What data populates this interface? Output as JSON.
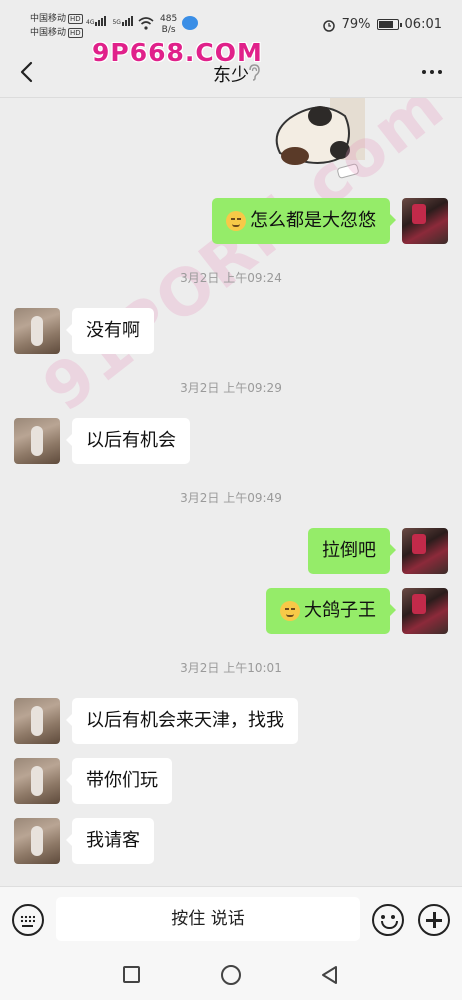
{
  "status_bar": {
    "carrier1": "中国移动",
    "carrier2": "中国移动",
    "hd": "HD",
    "net1": "4G",
    "net2": "5G",
    "speed_value": "485",
    "speed_unit": "B/s",
    "battery": "79%",
    "time": "06:01",
    "watermark": "9P668.COM"
  },
  "nav": {
    "title": "东少"
  },
  "watermark_diag": "91PORN.com",
  "messages": [
    {
      "side": "right",
      "text": "怎么都是大忽悠",
      "emoji": true
    },
    {
      "type": "time",
      "text": "3月2日 上午09:24"
    },
    {
      "side": "left",
      "text": "没有啊"
    },
    {
      "type": "time",
      "text": "3月2日 上午09:29"
    },
    {
      "side": "left",
      "text": "以后有机会"
    },
    {
      "type": "time",
      "text": "3月2日 上午09:49"
    },
    {
      "side": "right",
      "text": "拉倒吧"
    },
    {
      "side": "right",
      "text": "大鸽子王",
      "emoji": true
    },
    {
      "type": "time",
      "text": "3月2日 上午10:01"
    },
    {
      "side": "left",
      "text": "以后有机会来天津，找我"
    },
    {
      "side": "left",
      "text": "带你们玩"
    },
    {
      "side": "left",
      "text": "我请客"
    }
  ],
  "input_bar": {
    "hold_to_talk": "按住 说话"
  },
  "colors": {
    "self_bubble": "#95ec69",
    "other_bubble": "#ffffff",
    "background": "#ededed"
  }
}
